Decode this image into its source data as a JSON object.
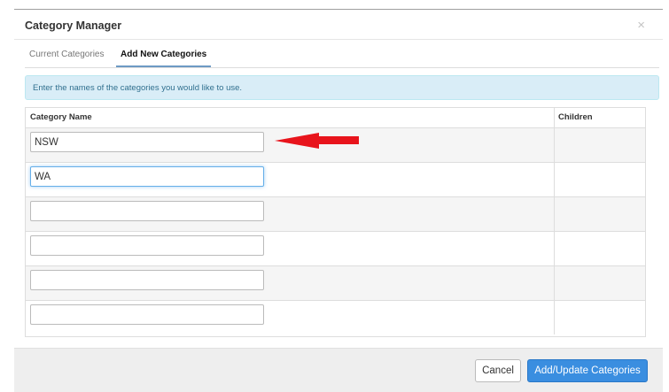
{
  "dialog": {
    "title": "Category Manager",
    "close_symbol": "×"
  },
  "tabs": [
    {
      "label": "Current Categories",
      "active": false
    },
    {
      "label": "Add New Categories",
      "active": true
    }
  ],
  "info": {
    "text": "Enter the names of the categories you would like to use."
  },
  "table": {
    "headers": {
      "name": "Category Name",
      "children": "Children"
    },
    "rows": [
      {
        "value": "NSW"
      },
      {
        "value": "WA"
      },
      {
        "value": ""
      },
      {
        "value": ""
      },
      {
        "value": ""
      },
      {
        "value": ""
      }
    ]
  },
  "annotation": {
    "arrow_color": "#e8141c",
    "points_to": "first category input"
  },
  "footer": {
    "cancel_label": "Cancel",
    "submit_label": "Add/Update Categories"
  },
  "colors": {
    "primary": "#3a8ee0",
    "info_bg": "#d9edf7",
    "info_text": "#31708f"
  }
}
